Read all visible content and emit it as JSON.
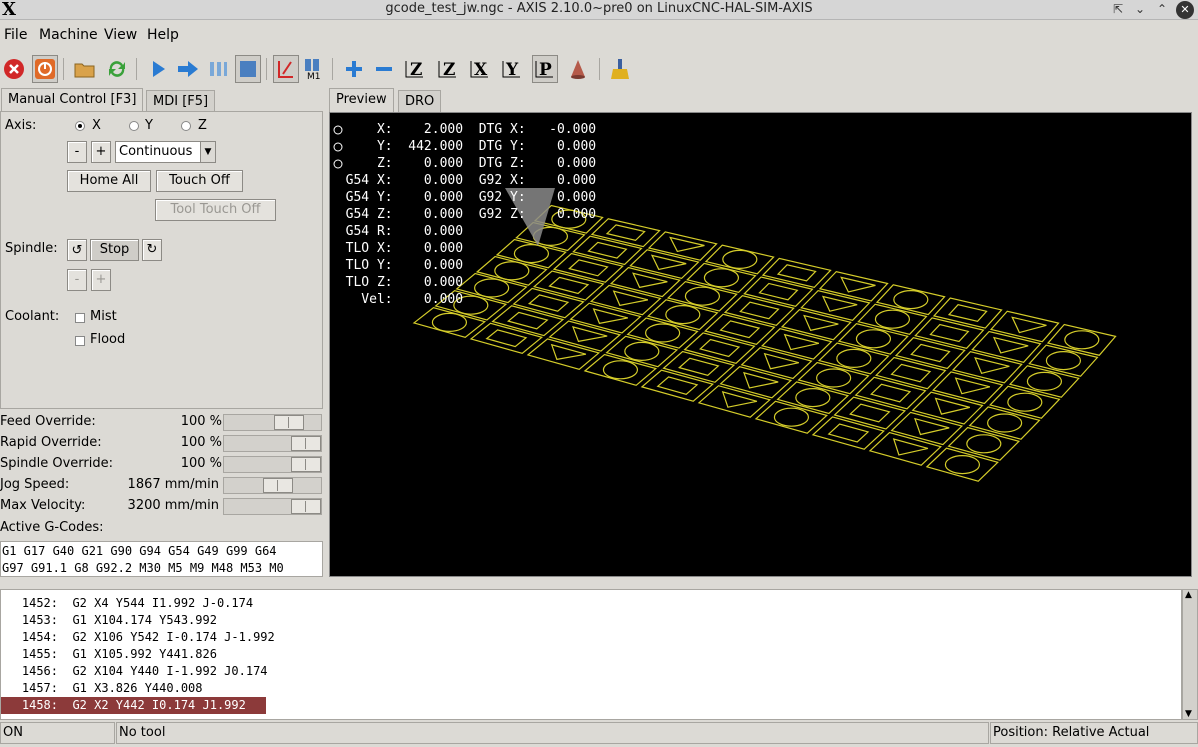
{
  "window": {
    "title": "gcode_test_jw.ngc - AXIS 2.10.0~pre0 on LinuxCNC-HAL-SIM-AXIS",
    "logo": "X"
  },
  "menu": [
    "File",
    "Machine",
    "View",
    "Help"
  ],
  "tabs_left": [
    "Manual Control [F3]",
    "MDI [F5]"
  ],
  "tabs_right": [
    "Preview",
    "DRO"
  ],
  "manual": {
    "axis_label": "Axis:",
    "axes": [
      "X",
      "Y",
      "Z"
    ],
    "selected_axis": "X",
    "minus": "-",
    "plus": "+",
    "jog_mode": "Continuous",
    "home_all": "Home All",
    "touch_off": "Touch Off",
    "tool_touch_off": "Tool Touch Off",
    "spindle_label": "Spindle:",
    "spindle_stop": "Stop",
    "coolant_label": "Coolant:",
    "mist": "Mist",
    "flood": "Flood"
  },
  "sliders": [
    {
      "label": "Feed Override:",
      "value": "100 %",
      "position": 0.75
    },
    {
      "label": "Rapid Override:",
      "value": "100 %",
      "position": 1.0
    },
    {
      "label": "Spindle Override:",
      "value": "100 %",
      "position": 1.0
    },
    {
      "label": "Jog Speed:",
      "value": "1867 mm/min",
      "position": 0.58
    },
    {
      "label": "Max Velocity:",
      "value": "3200 mm/min",
      "position": 1.0
    }
  ],
  "active_gcodes_label": "Active G-Codes:",
  "active_gcodes": [
    "G1 G17 G40 G21 G90 G94 G54 G49 G99 G64",
    "G97 G91.1 G8 G92.2 M30 M5 M9 M48 M53 M0"
  ],
  "dro_lines": [
    "      X:    2.000  DTG X:   -0.000",
    "      Y:  442.000  DTG Y:    0.000",
    "      Z:    0.000  DTG Z:    0.000",
    "  G54 X:    0.000  G92 X:    0.000",
    "  G54 Y:    0.000  G92 Y:    0.000",
    "  G54 Z:    0.000  G92 Z:    0.000",
    "  G54 R:    0.000",
    "  TLO X:    0.000",
    "  TLO Y:    0.000",
    "  TLO Z:    0.000",
    "    Vel:    0.000"
  ],
  "gcode_lines": [
    {
      "num": "1452:",
      "code": "G2 X4 Y544 I1.992 J-0.174"
    },
    {
      "num": "1453:",
      "code": "G1 X104.174 Y543.992"
    },
    {
      "num": "1454:",
      "code": "G2 X106 Y542 I-0.174 J-1.992"
    },
    {
      "num": "1455:",
      "code": "G1 X105.992 Y441.826"
    },
    {
      "num": "1456:",
      "code": "G2 X104 Y440 I-1.992 J0.174"
    },
    {
      "num": "1457:",
      "code": "G1 X3.826 Y440.008"
    },
    {
      "num": "1458:",
      "code": "G2 X2 Y442 I0.174 J1.992"
    }
  ],
  "status": {
    "machine": "ON",
    "tool": "No tool",
    "position": "Position: Relative Actual"
  },
  "colors": {
    "toolpath": "#d4cc2a",
    "current_line": "#8c3a3a"
  }
}
